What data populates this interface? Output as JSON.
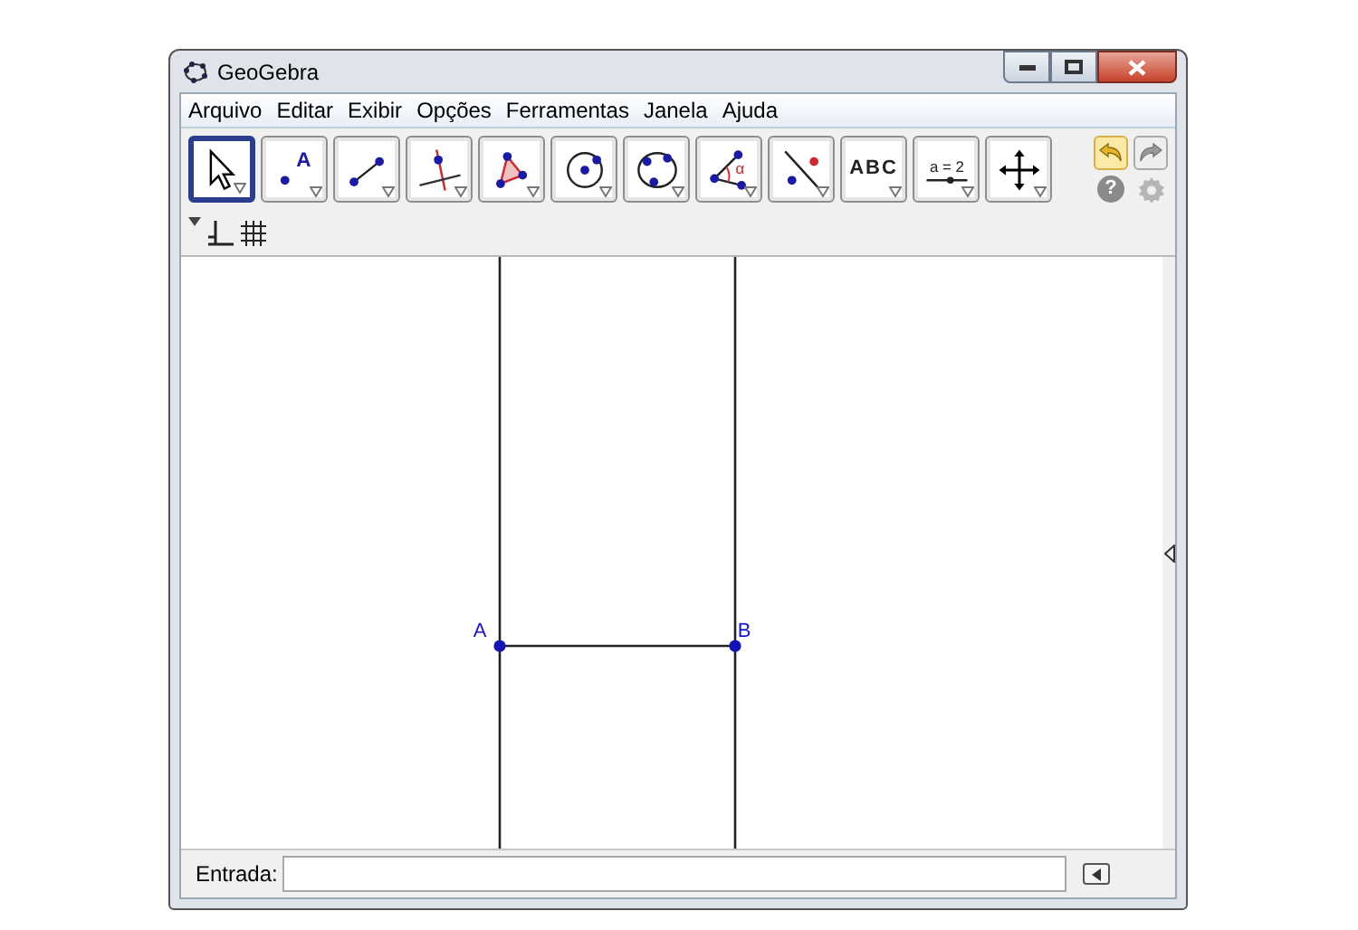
{
  "window": {
    "title": "GeoGebra"
  },
  "menu": [
    {
      "label": "Arquivo"
    },
    {
      "label": "Editar"
    },
    {
      "label": "Exibir"
    },
    {
      "label": "Opções"
    },
    {
      "label": "Ferramentas"
    },
    {
      "label": "Janela"
    },
    {
      "label": "Ajuda"
    }
  ],
  "tools": [
    {
      "selected": true
    },
    {
      "selected": false,
      "label": "A"
    },
    {
      "selected": false
    },
    {
      "selected": false
    },
    {
      "selected": false
    },
    {
      "selected": false
    },
    {
      "selected": false
    },
    {
      "selected": false,
      "label": "α"
    },
    {
      "selected": false
    },
    {
      "selected": false,
      "label": "ABC"
    },
    {
      "selected": false,
      "label": "a = 2"
    },
    {
      "selected": false
    }
  ],
  "undo": {
    "disabled": false
  },
  "redo": {
    "disabled": true
  },
  "help_button": {
    "label": "?"
  },
  "graphics": {
    "points": [
      {
        "label": "A"
      },
      {
        "label": "B"
      }
    ]
  },
  "input_bar": {
    "label": "Entrada:"
  }
}
